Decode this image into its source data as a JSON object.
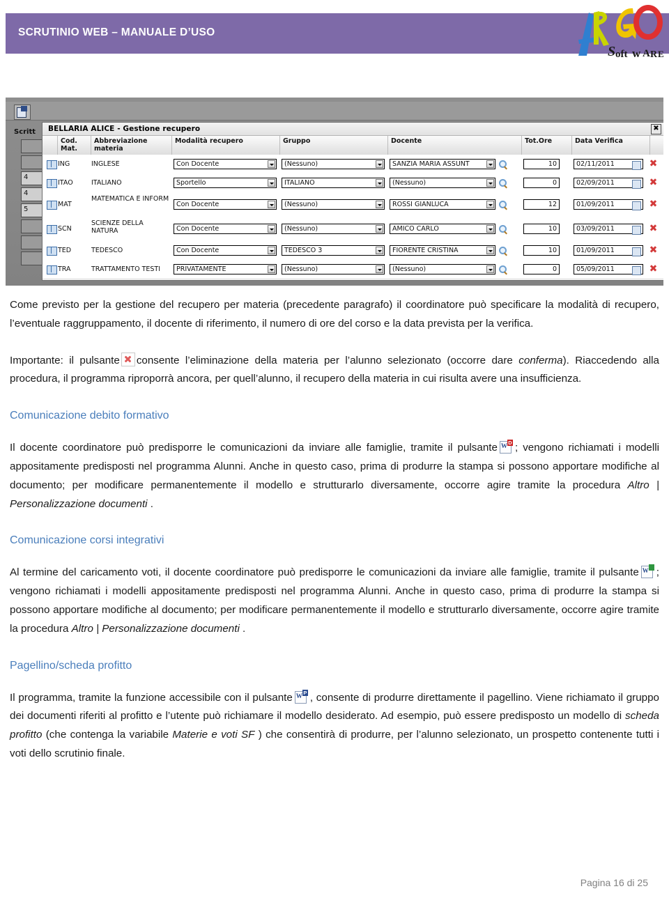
{
  "header": {
    "title": "SCRUTINIO WEB – MANUALE D’USO",
    "band_color": "#7e6aa8",
    "logo": {
      "letters": [
        "A",
        "R",
        "G",
        "O"
      ],
      "letter_colors": [
        "#2f7fd0",
        "#c9d400",
        "#f0c400",
        "#e03030"
      ],
      "wordmark": "SoftwARE"
    }
  },
  "screenshot": {
    "background_window": {
      "label": "Scritt",
      "toolbar_icon": "new-window-icon",
      "value_boxes": [
        "",
        "",
        "4",
        "4",
        "5",
        "",
        "",
        ""
      ]
    },
    "dialog": {
      "title": "BELLARIA ALICE - Gestione recupero",
      "close_label": "✖",
      "columns": [
        "Cod.\nMat.",
        "Abbreviazione\nmateria",
        "Modalità recupero",
        "Gruppo",
        "Docente",
        "Tot.Ore",
        "Data Verifica",
        ""
      ],
      "rows": [
        {
          "icon": "book-icon",
          "cod": "ING",
          "materia": "INGLESE",
          "modalita": "Con Docente",
          "gruppo": "(Nessuno)",
          "docente": "SANZIA MARIA ASSUNT",
          "ore": "10",
          "data": "02/11/2011"
        },
        {
          "icon": "book-icon",
          "cod": "ITAO",
          "materia": "ITALIANO",
          "modalita": "Sportello",
          "gruppo": "ITALIANO",
          "docente": "(Nessuno)",
          "ore": "0",
          "data": "02/09/2011"
        },
        {
          "icon": "book-icon",
          "cod": "MAT",
          "materia": "MATEMATICA E INFORM",
          "modalita": "Con Docente",
          "gruppo": "(Nessuno)",
          "docente": "ROSSI GIANLUCA",
          "ore": "12",
          "data": "01/09/2011"
        },
        {
          "icon": "book-icon",
          "cod": "SCN",
          "materia": "SCIENZE DELLA NATURA",
          "modalita": "Con Docente",
          "gruppo": "(Nessuno)",
          "docente": "AMICO CARLO",
          "ore": "10",
          "data": "03/09/2011"
        },
        {
          "icon": "book-icon",
          "cod": "TED",
          "materia": "TEDESCO",
          "modalita": "Con Docente",
          "gruppo": "TEDESCO 3",
          "docente": "FIORENTE CRISTINA",
          "ore": "10",
          "data": "01/09/2011"
        },
        {
          "icon": "book-icon",
          "cod": "TRA",
          "materia": "TRATTAMENTO TESTI",
          "modalita": "PRIVATAMENTE",
          "gruppo": "(Nessuno)",
          "docente": "(Nessuno)",
          "ore": "0",
          "data": "05/09/2011"
        }
      ],
      "row_lens_icon": "magnifier-icon",
      "row_calendar_icon": "calendar-icon",
      "row_delete_icon": "red-x-delete-icon"
    }
  },
  "document": {
    "para1": "Come previsto per la gestione del recupero per materia (precedente paragrafo) il coordinatore può specificare la modalità di recupero, l’eventuale raggruppamento, il docente di riferimento, il numero di ore del corso e la data prevista per la verifica.",
    "para2_before": "Importante:  il  pulsante",
    "para2_after_a": "consente  l’eliminazione  della  materia  per  l’alunno  selezionato  (occorre  dare  ",
    "para2_italic": "conferma",
    "para2_after_b": ").  Riaccedendo alla  procedura,  il programma riproporrà ancora, per quell’alunno, il recupero della materia in cui risulta avere una insufficienza.",
    "section1_heading": "Comunicazione debito formativo",
    "section1_before": "Il  docente  coordinatore  può  predisporre  le  comunicazioni  da  inviare  alle  famiglie,  tramite  il  pulsante",
    "section1_after": "; vengono richiamati i modelli appositamente predisposti nel programma Alunni. Anche in questo caso, prima di produrre la stampa si possono apportare  modifiche al documento; per modificare permanentemente il modello e strutturarlo diversamente, occorre agire tramite la procedura ",
    "section1_italic": "Altro | Personalizzazione documenti",
    "section1_tail": " .",
    "section2_heading": "Comunicazione corsi integrativi",
    "section2_before": "Al  termine  del  caricamento  voti,  il  docente  coordinatore  può  predisporre  le  comunicazioni  da  inviare  alle famiglie, tramite il pulsante",
    "section2_after": "; vengono richiamati i modelli appositamente predisposti nel programma Alunni. Anche  in  questo  caso,  prima  di  produrre  la  stampa  si  possono  apportare    modifiche  al  documento;  per modificare permanentemente il modello e strutturarlo diversamente, occorre agire tramite la procedura ",
    "section2_italic": "Altro | Personalizzazione documenti",
    "section2_tail": " .",
    "section3_heading": "Pagellino/scheda profitto",
    "section3_before": "Il programma, tramite la funzione accessibile con il pulsante",
    "section3_after_a": ",  consente di produrre direttamente il pagellino. Viene richiamato il gruppo dei documenti riferiti al profitto e l’utente può richiamare il modello desiderato. Ad esempio, può essere predisposto un modello di ",
    "section3_italic1": "scheda profitto",
    "section3_mid": " (che contenga la variabile  ",
    "section3_italic2": "Materie e voti SF",
    "section3_after_b": " ) che consentirà di produrre, per l’alunno selezionato, un prospetto contenente tutti i voti dello scrutinio finale.",
    "heading_color": "#4a7ebb",
    "icons": {
      "delete": "red-x-icon",
      "word_pdf": "word-document-icon",
      "word_green": "word-document-icon",
      "word_blue": "word-document-icon"
    }
  },
  "footer": {
    "page_text": "Pagina 16 di 25"
  }
}
